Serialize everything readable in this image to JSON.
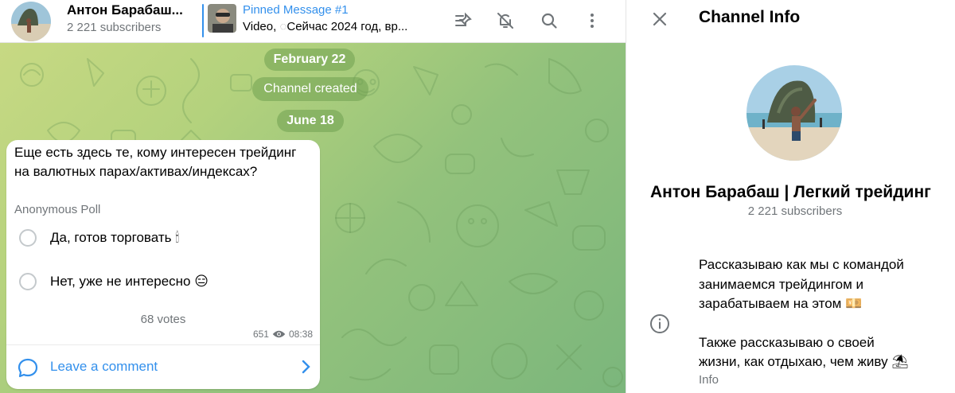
{
  "header": {
    "channel_name": "Антон Барабаш | Легкий трейдинг",
    "channel_name_short": "Антон Барабаш...",
    "subscribers": "2 221 subscribers"
  },
  "pinned": {
    "title": "Pinned Message #1",
    "type": "Video,",
    "text": "Сейчас 2024 год, вр..."
  },
  "header_actions": [
    "pin-list-icon",
    "mute-bell-icon",
    "search-icon",
    "more-vertical-icon"
  ],
  "timeline": {
    "date1": "February 22",
    "service": "Channel created",
    "date2": "June 18"
  },
  "poll": {
    "question": "Еще есть здесь те, кому интересен трейдинг на валютных парах/активах/индексах?",
    "type": "Anonymous Poll",
    "options": [
      {
        "label": "Да, готов торговать 🕯"
      },
      {
        "label": "Нет, уже не интересно 😑"
      }
    ],
    "votes": "68 votes",
    "views": "651",
    "time": "08:38",
    "comment_label": "Leave a comment"
  },
  "info_panel": {
    "title": "Channel Info",
    "name": "Антон Барабаш | Легкий трейдинг",
    "subscribers": "2 221 subscribers",
    "description_1": "Рассказываю как мы с командой\nзанимаемся трейдингом и\nзарабатываем на этом 💴",
    "description_2": "Также рассказываю о своей\nжизни, как отдыхаю, чем живу ⛱",
    "description_label": "Info"
  },
  "colors": {
    "accent": "#3390ec",
    "secondary_text": "#707579",
    "chat_bg_start": "#c7d983",
    "chat_bg_end": "#7bb67c",
    "bubble": "#ffffff"
  }
}
